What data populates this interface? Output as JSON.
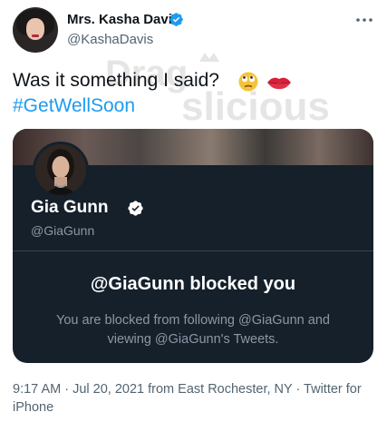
{
  "author": {
    "display_name": "Mrs. Kasha Davis",
    "handle": "@KashaDavis"
  },
  "tweet": {
    "text": "Was it something I said?",
    "hashtag": "#GetWellSoon",
    "emojis": [
      "face-with-rolling-eyes",
      "kiss-mark-lips"
    ]
  },
  "watermark": {
    "line1": "Drag",
    "line2": "slicious"
  },
  "embedded_card": {
    "name": "Gia Gunn",
    "handle": "@GiaGunn",
    "blocked_title": "@GiaGunn blocked you",
    "blocked_description": "You are blocked from following @GiaGunn and viewing @GiaGunn's Tweets."
  },
  "footer": {
    "meta": "9:17 AM · Jul 20, 2021 from East Rochester, NY · Twitter for iPhone"
  },
  "colors": {
    "link_blue": "#1d9bf0",
    "card_background": "#15202b",
    "verified_blue": "#1d9bf0",
    "secondary_text": "#536471"
  },
  "icons": {
    "verified": "verified-badge-icon",
    "more": "more-options-icon"
  }
}
